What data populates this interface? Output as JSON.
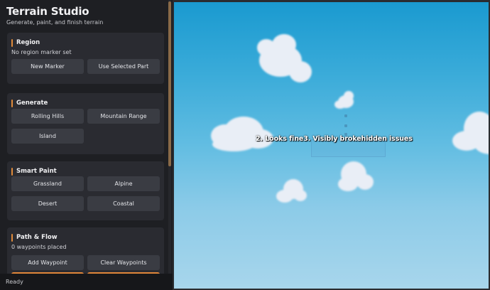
{
  "app": {
    "title": "Terrain Studio",
    "subtitle": "Generate, paint, and finish terrain"
  },
  "sections": {
    "region": {
      "title": "Region",
      "info": "No region marker set",
      "buttons": [
        "New Marker",
        "Use Selected Part"
      ]
    },
    "generate": {
      "title": "Generate",
      "buttons": [
        "Rolling Hills",
        "Mountain Range",
        "Island"
      ]
    },
    "smart_paint": {
      "title": "Smart Paint",
      "buttons": [
        "Grassland",
        "Alpine",
        "Desert",
        "Coastal"
      ]
    },
    "path_flow": {
      "title": "Path & Flow",
      "info": "0 waypoints placed",
      "buttons": [
        "Add Waypoint",
        "Clear Waypoints"
      ]
    }
  },
  "status": "Ready",
  "viewport": {
    "overlay_text": "2. Looks fine3. Visibly brokehidden issues"
  },
  "colors": {
    "accent": "#e0863a",
    "panel_bg": "#1e1f23",
    "card_bg": "#2a2b31",
    "button_bg": "#3a3c43",
    "sky_top": "#1a9ad0",
    "sky_bottom": "#a8d6ec"
  }
}
